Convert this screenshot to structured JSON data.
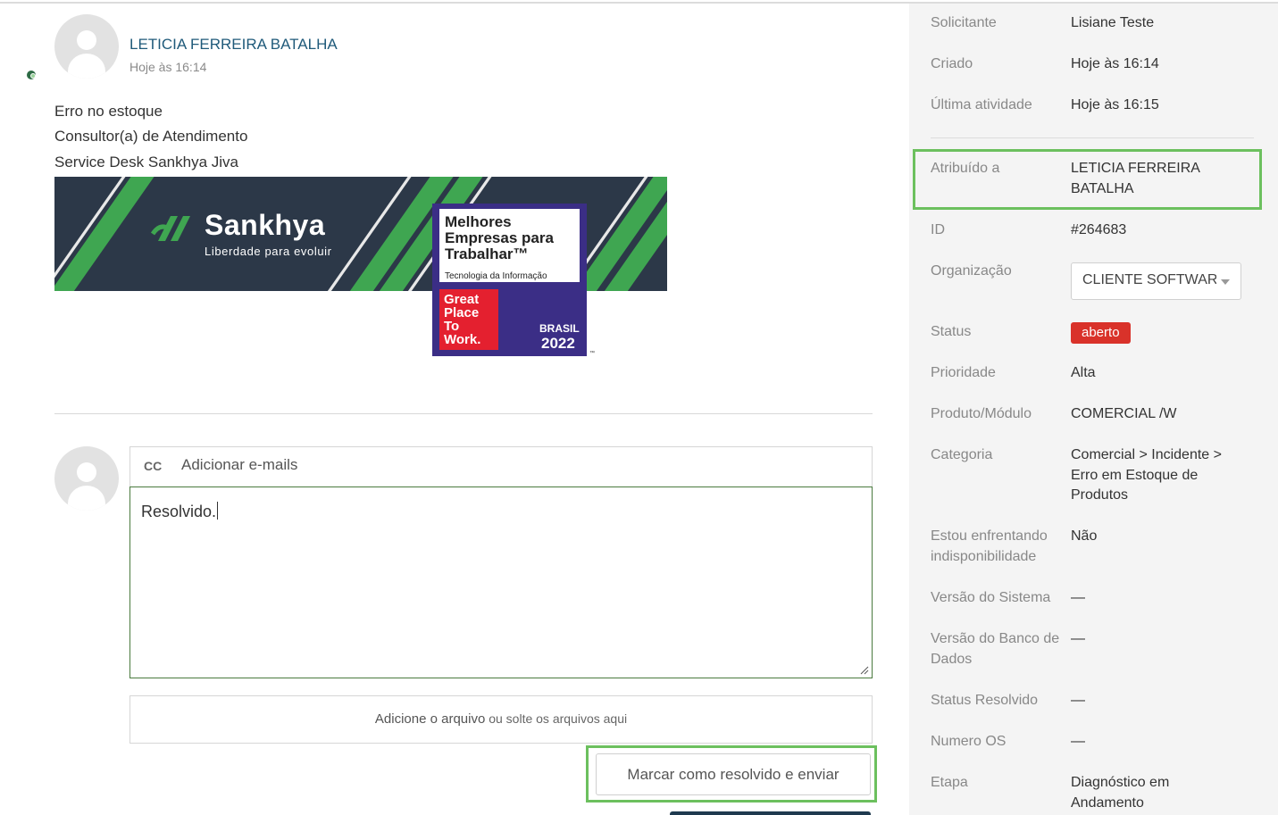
{
  "colors": {
    "highlight": "#6cc05e",
    "status_open": "#d9322a",
    "author_link": "#1f5a7a",
    "banner_bg": "#2c3848",
    "brand_green": "#3fa651"
  },
  "message": {
    "author": "LETICIA FERREIRA BATALHA",
    "timestamp": "Hoje às 16:14",
    "lines": [
      "Erro no estoque",
      "Consultor(a) de Atendimento",
      "Service Desk Sankhya Jiva"
    ],
    "signature_banner": {
      "brand": "Sankhya",
      "tagline": "Liberdade para evoluir",
      "award": {
        "title": "Melhores\nEmpresas para\nTrabalhar™",
        "subtitle": "Tecnologia da Informação",
        "seal": "Great\nPlace\nTo\nWork.",
        "country": "BRASIL",
        "year": "2022",
        "tm": "™"
      }
    }
  },
  "reply": {
    "cc_label": "CC",
    "cc_placeholder": "Adicionar e-mails",
    "body": "Resolvido.",
    "attach_link": "Adicione o arquivo",
    "attach_drop": " ou solte os arquivos aqui",
    "submit_label": "Marcar como resolvido e enviar"
  },
  "ticket": {
    "requester": {
      "label": "Solicitante",
      "value": "Lisiane Teste"
    },
    "created": {
      "label": "Criado",
      "value": "Hoje às 16:14"
    },
    "last_activity": {
      "label": "Última atividade",
      "value": "Hoje às 16:15"
    },
    "assignee": {
      "label": "Atribuído a",
      "value": "LETICIA FERREIRA BATALHA"
    },
    "id": {
      "label": "ID",
      "value": "#264683"
    },
    "organization": {
      "label": "Organização",
      "value": "CLIENTE SOFTWARE"
    },
    "status": {
      "label": "Status",
      "value": "aberto"
    },
    "priority": {
      "label": "Prioridade",
      "value": "Alta"
    },
    "product": {
      "label": "Produto/Módulo",
      "value": "COMERCIAL /W"
    },
    "category": {
      "label": "Categoria",
      "value": "Comercial > Incidente > Erro em Estoque de Produtos"
    },
    "unavailability": {
      "label": "Estou enfrentando indisponibilidade",
      "value": "Não"
    },
    "system_version": {
      "label": "Versão do Sistema",
      "value": "—"
    },
    "db_version": {
      "label": "Versão do Banco de Dados",
      "value": "—"
    },
    "resolved_status": {
      "label": "Status Resolvido",
      "value": "—"
    },
    "os_number": {
      "label": "Numero OS",
      "value": "—"
    },
    "stage": {
      "label": "Etapa",
      "value": "Diagnóstico em Andamento"
    }
  }
}
